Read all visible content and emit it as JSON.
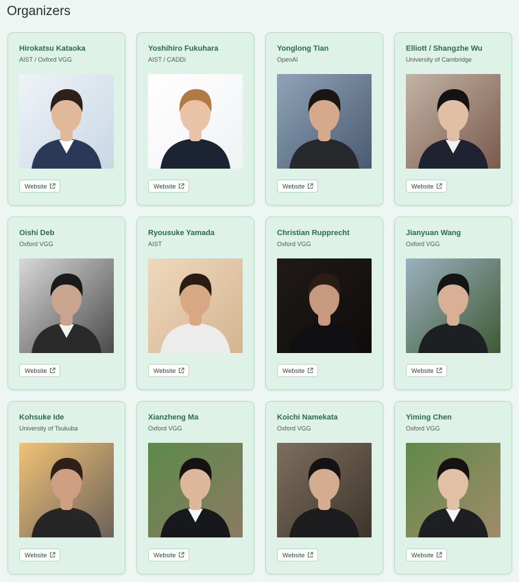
{
  "page": {
    "title": "Organizers"
  },
  "organizers": [
    {
      "name": "Hirokatsu Kataoka",
      "affiliation": "AIST / Oxford VGG",
      "link_label": "Website",
      "photo": {
        "bg": "#c9d7e4",
        "bg2": "#eef3f7",
        "hair": "#2d2018",
        "skin": "#e0b89a",
        "shirt": "#2b3858",
        "collar": "#ffffff"
      }
    },
    {
      "name": "Yoshihiro Fukuhara",
      "affiliation": "AIST / CADDi",
      "link_label": "Website",
      "photo": {
        "bg": "#f1f2f4",
        "bg2": "#ffffff",
        "hair": "#b07a42",
        "skin": "#e8c3a8",
        "shirt": "#1c2333",
        "collar": "#1c2333"
      }
    },
    {
      "name": "Yonglong Tian",
      "affiliation": "OpenAI",
      "link_label": "Website",
      "photo": {
        "bg": "#4b5a70",
        "bg2": "#8fa3b8",
        "hair": "#1a1412",
        "skin": "#d6a98b",
        "shirt": "#27292d",
        "collar": "#27292d"
      }
    },
    {
      "name": "Elliott / Shangzhe Wu",
      "affiliation": "University of Cambridge",
      "link_label": "Website",
      "photo": {
        "bg": "#7a5a4d",
        "bg2": "#c2b3a5",
        "hair": "#141213",
        "skin": "#e0bfa6",
        "shirt": "#1f2230",
        "collar": "#f2f2f2"
      }
    },
    {
      "name": "Oishi Deb",
      "affiliation": "Oxford VGG",
      "link_label": "Website",
      "photo": {
        "bg": "#4a4a4a",
        "bg2": "#d8d8d8",
        "hair": "#1a1a1a",
        "skin": "#c9a58f",
        "shirt": "#2a2a2a",
        "collar": "#f2f2f2"
      }
    },
    {
      "name": "Ryousuke Yamada",
      "affiliation": "AIST",
      "link_label": "Website",
      "photo": {
        "bg": "#d3b590",
        "bg2": "#efd8bd",
        "hair": "#2a1c14",
        "skin": "#d8a884",
        "shirt": "#ececec",
        "collar": "#ececec"
      }
    },
    {
      "name": "Christian Rupprecht",
      "affiliation": "Oxford VGG",
      "link_label": "Website",
      "photo": {
        "bg": "#0e0c0b",
        "bg2": "#1f1a17",
        "hair": "#2b1d15",
        "skin": "#c79a80",
        "shirt": "#101012",
        "collar": "#101012"
      }
    },
    {
      "name": "Jianyuan Wang",
      "affiliation": "Oxford VGG",
      "link_label": "Website",
      "photo": {
        "bg": "#3e5a33",
        "bg2": "#9bb0c0",
        "hair": "#151413",
        "skin": "#d7b095",
        "shirt": "#1e1f22",
        "collar": "#1e1f22"
      }
    },
    {
      "name": "Kohsuke Ide",
      "affiliation": "University of Tsukuba",
      "link_label": "Website",
      "photo": {
        "bg": "#6b6258",
        "bg2": "#f1c277",
        "hair": "#2d2018",
        "skin": "#cf9f82",
        "shirt": "#262626",
        "collar": "#262626"
      }
    },
    {
      "name": "Xianzheng Ma",
      "affiliation": "Oxford VGG",
      "link_label": "Website",
      "photo": {
        "bg": "#8a7a63",
        "bg2": "#5d8a4a",
        "hair": "#141212",
        "skin": "#dcb79b",
        "shirt": "#17181b",
        "collar": "#f5f5f5"
      }
    },
    {
      "name": "Koichi Namekata",
      "affiliation": "Oxford VGG",
      "link_label": "Website",
      "photo": {
        "bg": "#3d342a",
        "bg2": "#7d6f5f",
        "hair": "#141212",
        "skin": "#d4ac8f",
        "shirt": "#1d1d1f",
        "collar": "#1d1d1f"
      }
    },
    {
      "name": "Yiming Chen",
      "affiliation": "Oxford VGG",
      "link_label": "Website",
      "photo": {
        "bg": "#a08b6a",
        "bg2": "#5f8a48",
        "hair": "#141212",
        "skin": "#e2c0a6",
        "shirt": "#1e1f22",
        "collar": "#f5f5f5"
      }
    }
  ]
}
